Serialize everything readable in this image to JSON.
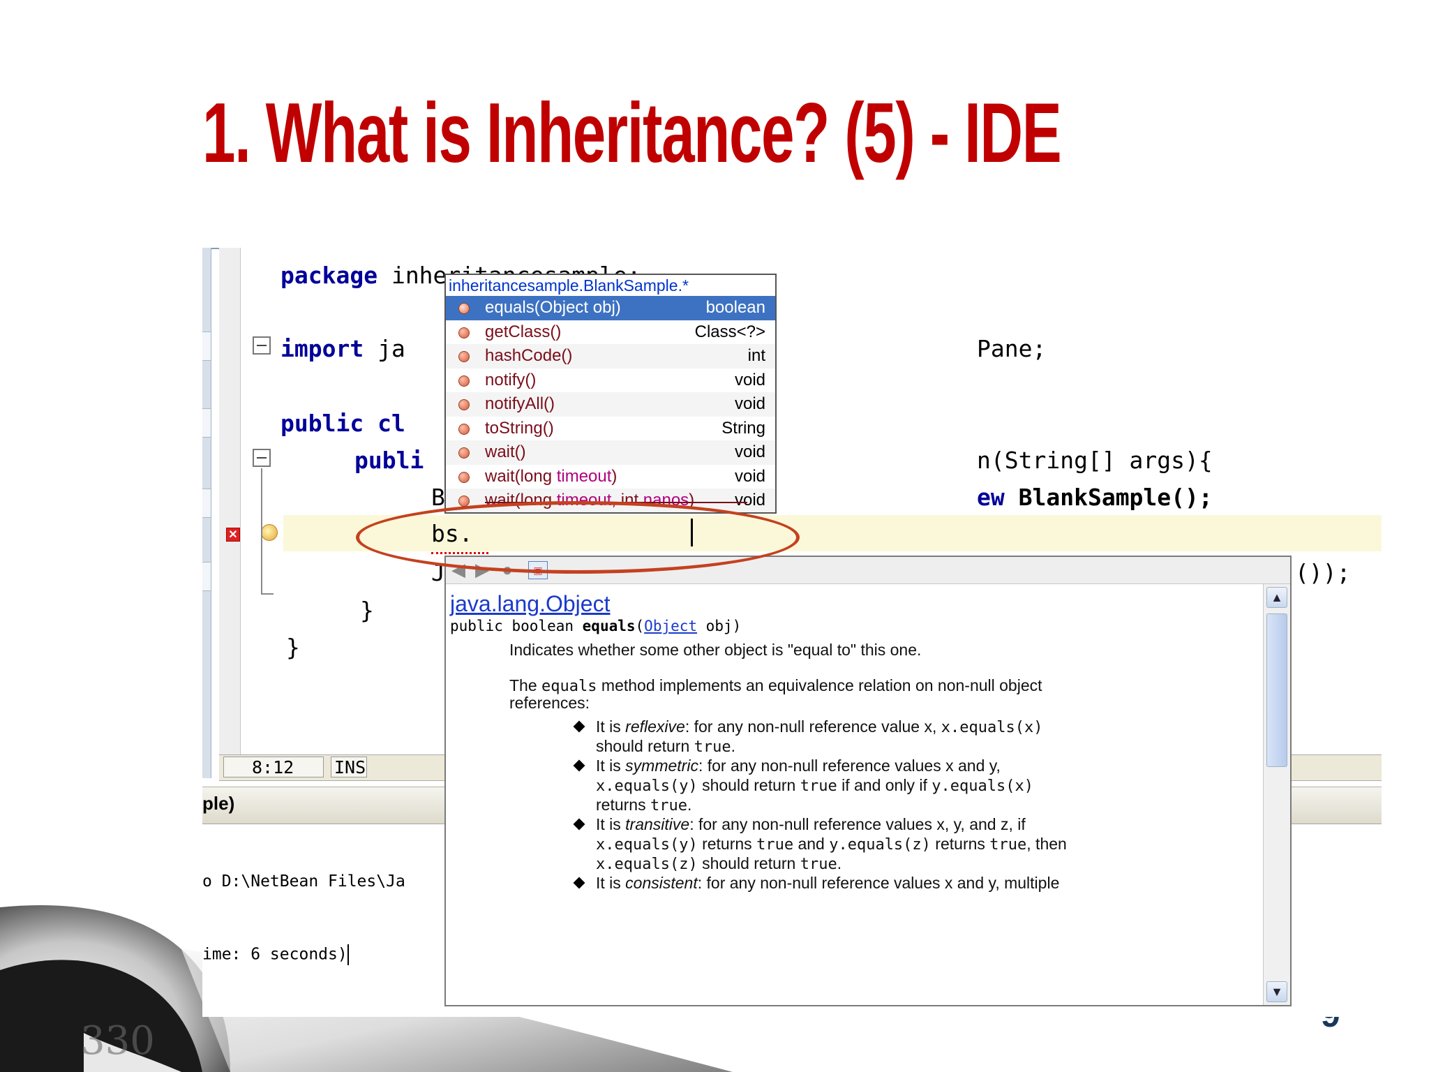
{
  "slide": {
    "title": "1. What is Inheritance? (5) - IDE",
    "page_number": "9",
    "decoration_text": "330"
  },
  "editor": {
    "code_lines": {
      "package_kw": "package",
      "package_rest": " inheritancesample;",
      "import_kw": "import",
      "import_rest": " ja",
      "import_tail": "Pane;",
      "class_kw": "public",
      "class_rest": " cl",
      "main_kw": "publi",
      "main_tail": "n(String[] args){",
      "decl_left": "B",
      "decl_new": "ew",
      "decl_tail": " BlankSample();",
      "current_line": "bs.",
      "joption_left": "J",
      "joption_tail": "());",
      "close_inner": "}",
      "close_outer": "}"
    },
    "status": {
      "position": "8:12",
      "mode": "INS"
    }
  },
  "output": {
    "tab_label": "ple)",
    "line1": "o D:\\NetBean Files\\Ja",
    "line2": "ime: 6 seconds)"
  },
  "completion": {
    "header": "inheritancesample.BlankSample.*",
    "items": [
      {
        "name": "equals(Object obj)",
        "type": "boolean",
        "selected": true
      },
      {
        "name": "getClass()",
        "type": "Class<?>"
      },
      {
        "name": "hashCode()",
        "type": "int"
      },
      {
        "name": "notify()",
        "type": "void"
      },
      {
        "name": "notifyAll()",
        "type": "void"
      },
      {
        "name": "toString()",
        "type": "String"
      },
      {
        "name": "wait()",
        "type": "void"
      },
      {
        "name_pre": "wait(long ",
        "name_param": "timeout",
        "name_post": ")",
        "type": "void"
      },
      {
        "name_pre": "wait(long ",
        "name_param": "timeout",
        "name_mid": ", int ",
        "name_param2": "nanos",
        "name_post": ")",
        "type": "void"
      }
    ]
  },
  "javadoc": {
    "class_link": "java.lang.Object",
    "signature_pre": "public boolean ",
    "signature_method": "equals",
    "signature_paren": "(",
    "signature_type": "Object",
    "signature_post": " obj)",
    "summary": "Indicates whether some other object is \"equal to\" this one.",
    "para_pre": "The ",
    "para_code": "equals",
    "para_post": " method implements an equivalence relation on non-null object",
    "para_line2": "references:",
    "bullets": [
      {
        "pre": "It is ",
        "term": "reflexive",
        "post": ": for any non-null reference value x, ",
        "code1": "x.equals(x)",
        "line2_pre": "should return ",
        "line2_code": "true",
        "line2_post": "."
      },
      {
        "pre": "It is ",
        "term": "symmetric",
        "post": ": for any non-null reference values x and y,",
        "code1": "x.equals(y)",
        "line2_mid": " should return ",
        "code2": "true",
        "line2_mid2": " if and only if ",
        "code3": "y.equals(x)",
        "line3_pre": "returns ",
        "line3_code": "true",
        "line3_post": "."
      },
      {
        "pre": "It is ",
        "term": "transitive",
        "post": ": for any non-null reference values x, y, and z, if",
        "code1": "x.equals(y)",
        "line2_mid": " returns ",
        "code2": "true",
        "line2_mid2": " and ",
        "code3": "y.equals(z)",
        "line2_mid3": " returns ",
        "code4": "true",
        "line2_end": ", then",
        "line3_code": "x.equals(z)",
        "line3_mid": " should return ",
        "line3_code2": "true",
        "line3_post": "."
      },
      {
        "pre": "It is ",
        "term": "consistent",
        "post": ": for any non-null reference values x and y, multiple"
      }
    ]
  },
  "colors": {
    "title": "#c00000",
    "selection": "#3d72c2",
    "annotation": "#c4411f",
    "keyword": "#000099",
    "link": "#1a3acb"
  },
  "icons": [
    "error-icon",
    "lightbulb-icon",
    "back-icon",
    "forward-icon",
    "stop-icon",
    "open-browser-icon",
    "scroll-up-icon",
    "scroll-down-icon"
  ]
}
